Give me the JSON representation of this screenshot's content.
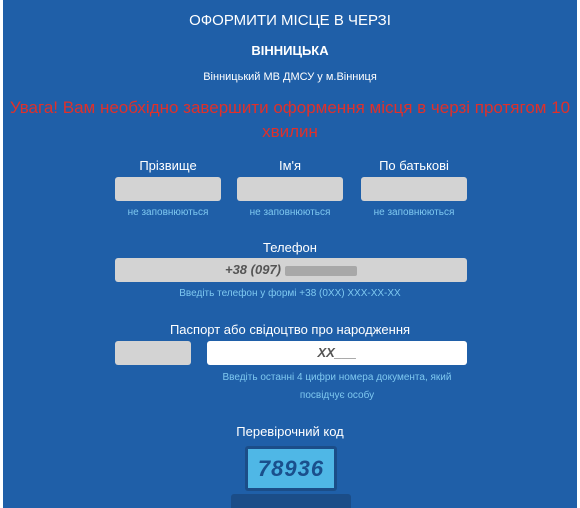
{
  "header": {
    "title": "ОФОРМИТИ МІСЦЕ В ЧЕРЗІ",
    "region": "ВІННИЦЬКА",
    "office": "Вінницький МВ ДМСУ у м.Вінниця"
  },
  "warning": "Увага! Вам необхідно завершити оформення місця в черзі протягом 10 хвилин",
  "name_fields": [
    {
      "label": "Прізвище",
      "hint": "не заповнюються"
    },
    {
      "label": "Ім'я",
      "hint": "не заповнюються"
    },
    {
      "label": "По батькові",
      "hint": "не заповнюються"
    }
  ],
  "phone": {
    "label": "Телефон",
    "value": "+38 (097)",
    "hint": "Введіть телефон у формі +38 (0XX) XXX-XX-XX"
  },
  "passport": {
    "label": "Паспорт або свідоцтво про народження",
    "number_value": "XX___",
    "hint": "Введіть останні 4 цифри номера документа, який посвідчує особу"
  },
  "captcha": {
    "label": "Перевірочний код",
    "image_text": "78936"
  },
  "colors": {
    "panel_bg": "#1f5fa8",
    "warning": "#e0302a",
    "hint": "#7ec8f0",
    "field_disabled": "#d3d3d3"
  }
}
